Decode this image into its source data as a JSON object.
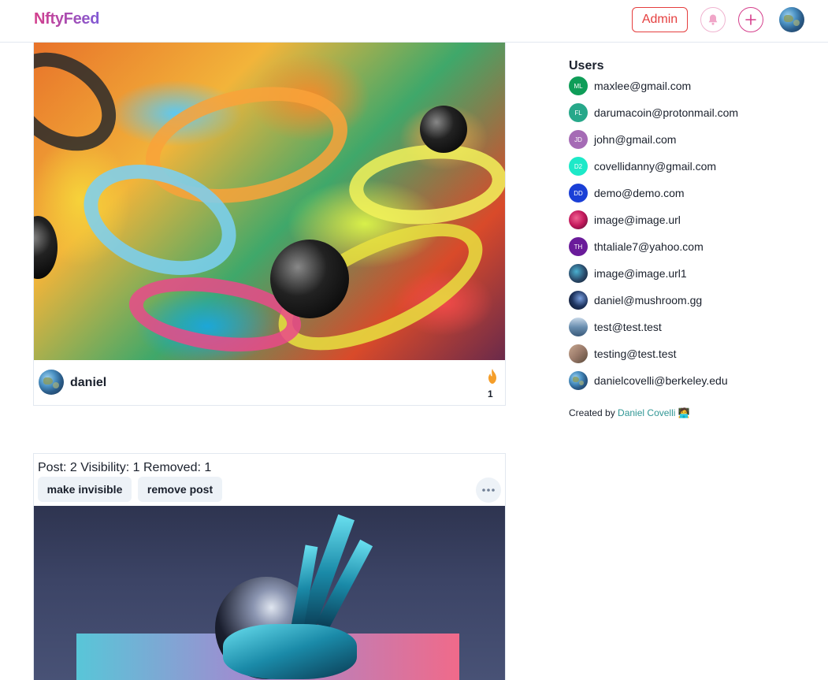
{
  "header": {
    "logo": "NftyFeed",
    "admin_label": "Admin",
    "icons": {
      "notifications": "bell-icon",
      "create": "plus-icon",
      "profile": "avatar"
    }
  },
  "post1": {
    "author": "daniel",
    "fire_count": "1",
    "reaction_icon": "flame-icon"
  },
  "post2": {
    "meta": "Post: 2 Visibility: 1 Removed: 1",
    "make_invisible_label": "make invisible",
    "remove_label": "remove post",
    "more_icon": "ellipsis-icon"
  },
  "sidebar": {
    "title": "Users",
    "users": [
      {
        "initials": "ML",
        "email": "maxlee@gmail.com",
        "color": "#0f9d58"
      },
      {
        "initials": "FL",
        "email": "darumacoin@protonmail.com",
        "color": "#27a88a"
      },
      {
        "initials": "JD",
        "email": "john@gmail.com",
        "color": "#a56bb5"
      },
      {
        "initials": "D2",
        "email": "covellidanny@gmail.com",
        "color": "#1de9c8"
      },
      {
        "initials": "DD",
        "email": "demo@demo.com",
        "color": "#1a3fd6"
      },
      {
        "initials": "",
        "email": "image@image.url",
        "color": "#c2185b"
      },
      {
        "initials": "TH",
        "email": "thtaliale7@yahoo.com",
        "color": "#6a1b9a"
      },
      {
        "initials": "",
        "email": "image@image.url1",
        "color": "#2a4a6a"
      },
      {
        "initials": "",
        "email": "daniel@mushroom.gg",
        "color": "#1f3560"
      },
      {
        "initials": "",
        "email": "test@test.test",
        "color": "#6a8fb0"
      },
      {
        "initials": "",
        "email": "testing@test.test",
        "color": "#9a7a6a"
      },
      {
        "initials": "",
        "email": "danielcovelli@berkeley.edu",
        "color": "#3a6a9a"
      }
    ],
    "credit_prefix": "Created by",
    "credit_name": "Daniel Covelli",
    "credit_emoji": "🧑‍💻"
  },
  "colors": {
    "brand_pink": "#d53f8c",
    "danger": "#e53e3e",
    "link_teal": "#319795"
  }
}
